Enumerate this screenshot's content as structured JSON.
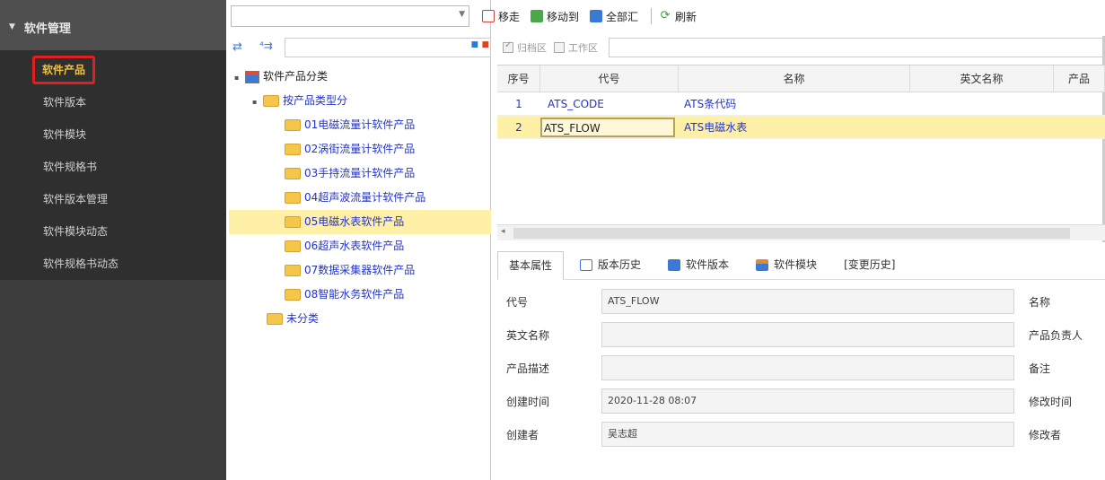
{
  "sidebar": {
    "title": "软件管理",
    "items": [
      {
        "label": "软件产品",
        "active": true
      },
      {
        "label": "软件版本"
      },
      {
        "label": "软件模块"
      },
      {
        "label": "软件规格书"
      },
      {
        "label": "软件版本管理"
      },
      {
        "label": "软件模块动态"
      },
      {
        "label": "软件规格书动态"
      }
    ]
  },
  "toolbar": {
    "buttons": [
      {
        "label": "移走",
        "icon": "remove-icon"
      },
      {
        "label": "移动到",
        "icon": "move-to-icon"
      },
      {
        "label": "全部汇",
        "icon": "summary-icon"
      },
      {
        "label": "刷新",
        "icon": "refresh-icon"
      }
    ]
  },
  "filter": {
    "opt1": "归档区",
    "opt2": "工作区"
  },
  "tree": {
    "root": "软件产品分类",
    "group": "按产品类型分",
    "children": [
      "01电磁流量计软件产品",
      "02涡街流量计软件产品",
      "03手持流量计软件产品",
      "04超声波流量计软件产品",
      "05电磁水表软件产品",
      "06超声水表软件产品",
      "07数据采集器软件产品",
      "08智能水务软件产品"
    ],
    "unclassified": "未分类",
    "selected_index": 4
  },
  "grid": {
    "headers": [
      "序号",
      "代号",
      "名称",
      "英文名称",
      "产品"
    ],
    "rows": [
      {
        "no": "1",
        "code": "ATS_CODE",
        "name": "ATS条代码"
      },
      {
        "no": "2",
        "code": "ATS_FLOW",
        "name": "ATS电磁水表"
      }
    ]
  },
  "tabs": [
    {
      "label": "基本属性",
      "active": true
    },
    {
      "label": "版本历史"
    },
    {
      "label": "软件版本"
    },
    {
      "label": "软件模块"
    },
    {
      "label": "[变更历史]"
    }
  ],
  "form": {
    "code_label": "代号",
    "code_value": "ATS_FLOW",
    "name_label": "名称",
    "en_label": "英文名称",
    "en_value": "",
    "owner_label": "产品负责人",
    "desc_label": "产品描述",
    "desc_value": "",
    "remark_label": "备注",
    "created_label": "创建时间",
    "created_value": "2020-11-28 08:07",
    "modified_label": "修改时间",
    "creator_label": "创建者",
    "creator_value": "吴志超",
    "modifier_label": "修改者"
  }
}
